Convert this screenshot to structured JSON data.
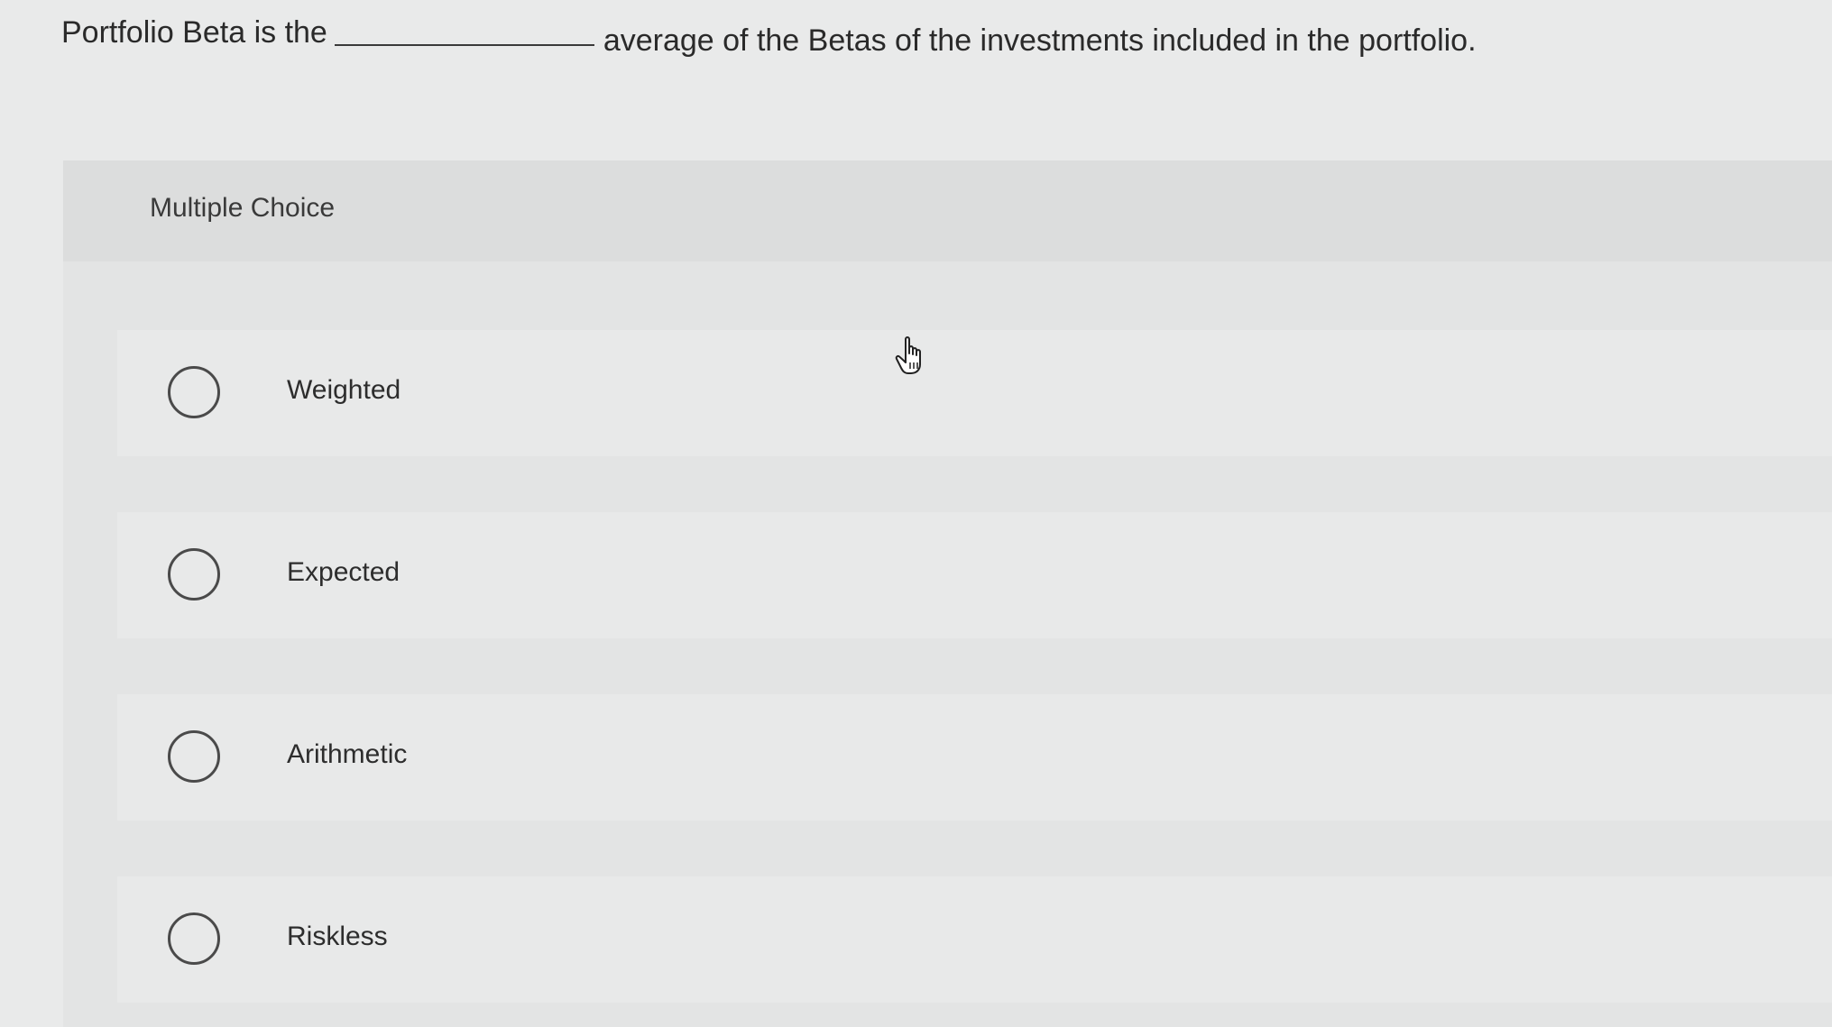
{
  "question": {
    "text_before": "Portfolio Beta is the",
    "text_after": "average of the Betas of the investments included in the portfolio."
  },
  "panel": {
    "title": "Multiple Choice"
  },
  "options": [
    {
      "label": "Weighted",
      "selected": false
    },
    {
      "label": "Expected",
      "selected": false
    },
    {
      "label": "Arithmetic",
      "selected": false
    },
    {
      "label": "Riskless",
      "selected": false
    }
  ],
  "cursor": {
    "icon": "hand-pointer-icon"
  }
}
